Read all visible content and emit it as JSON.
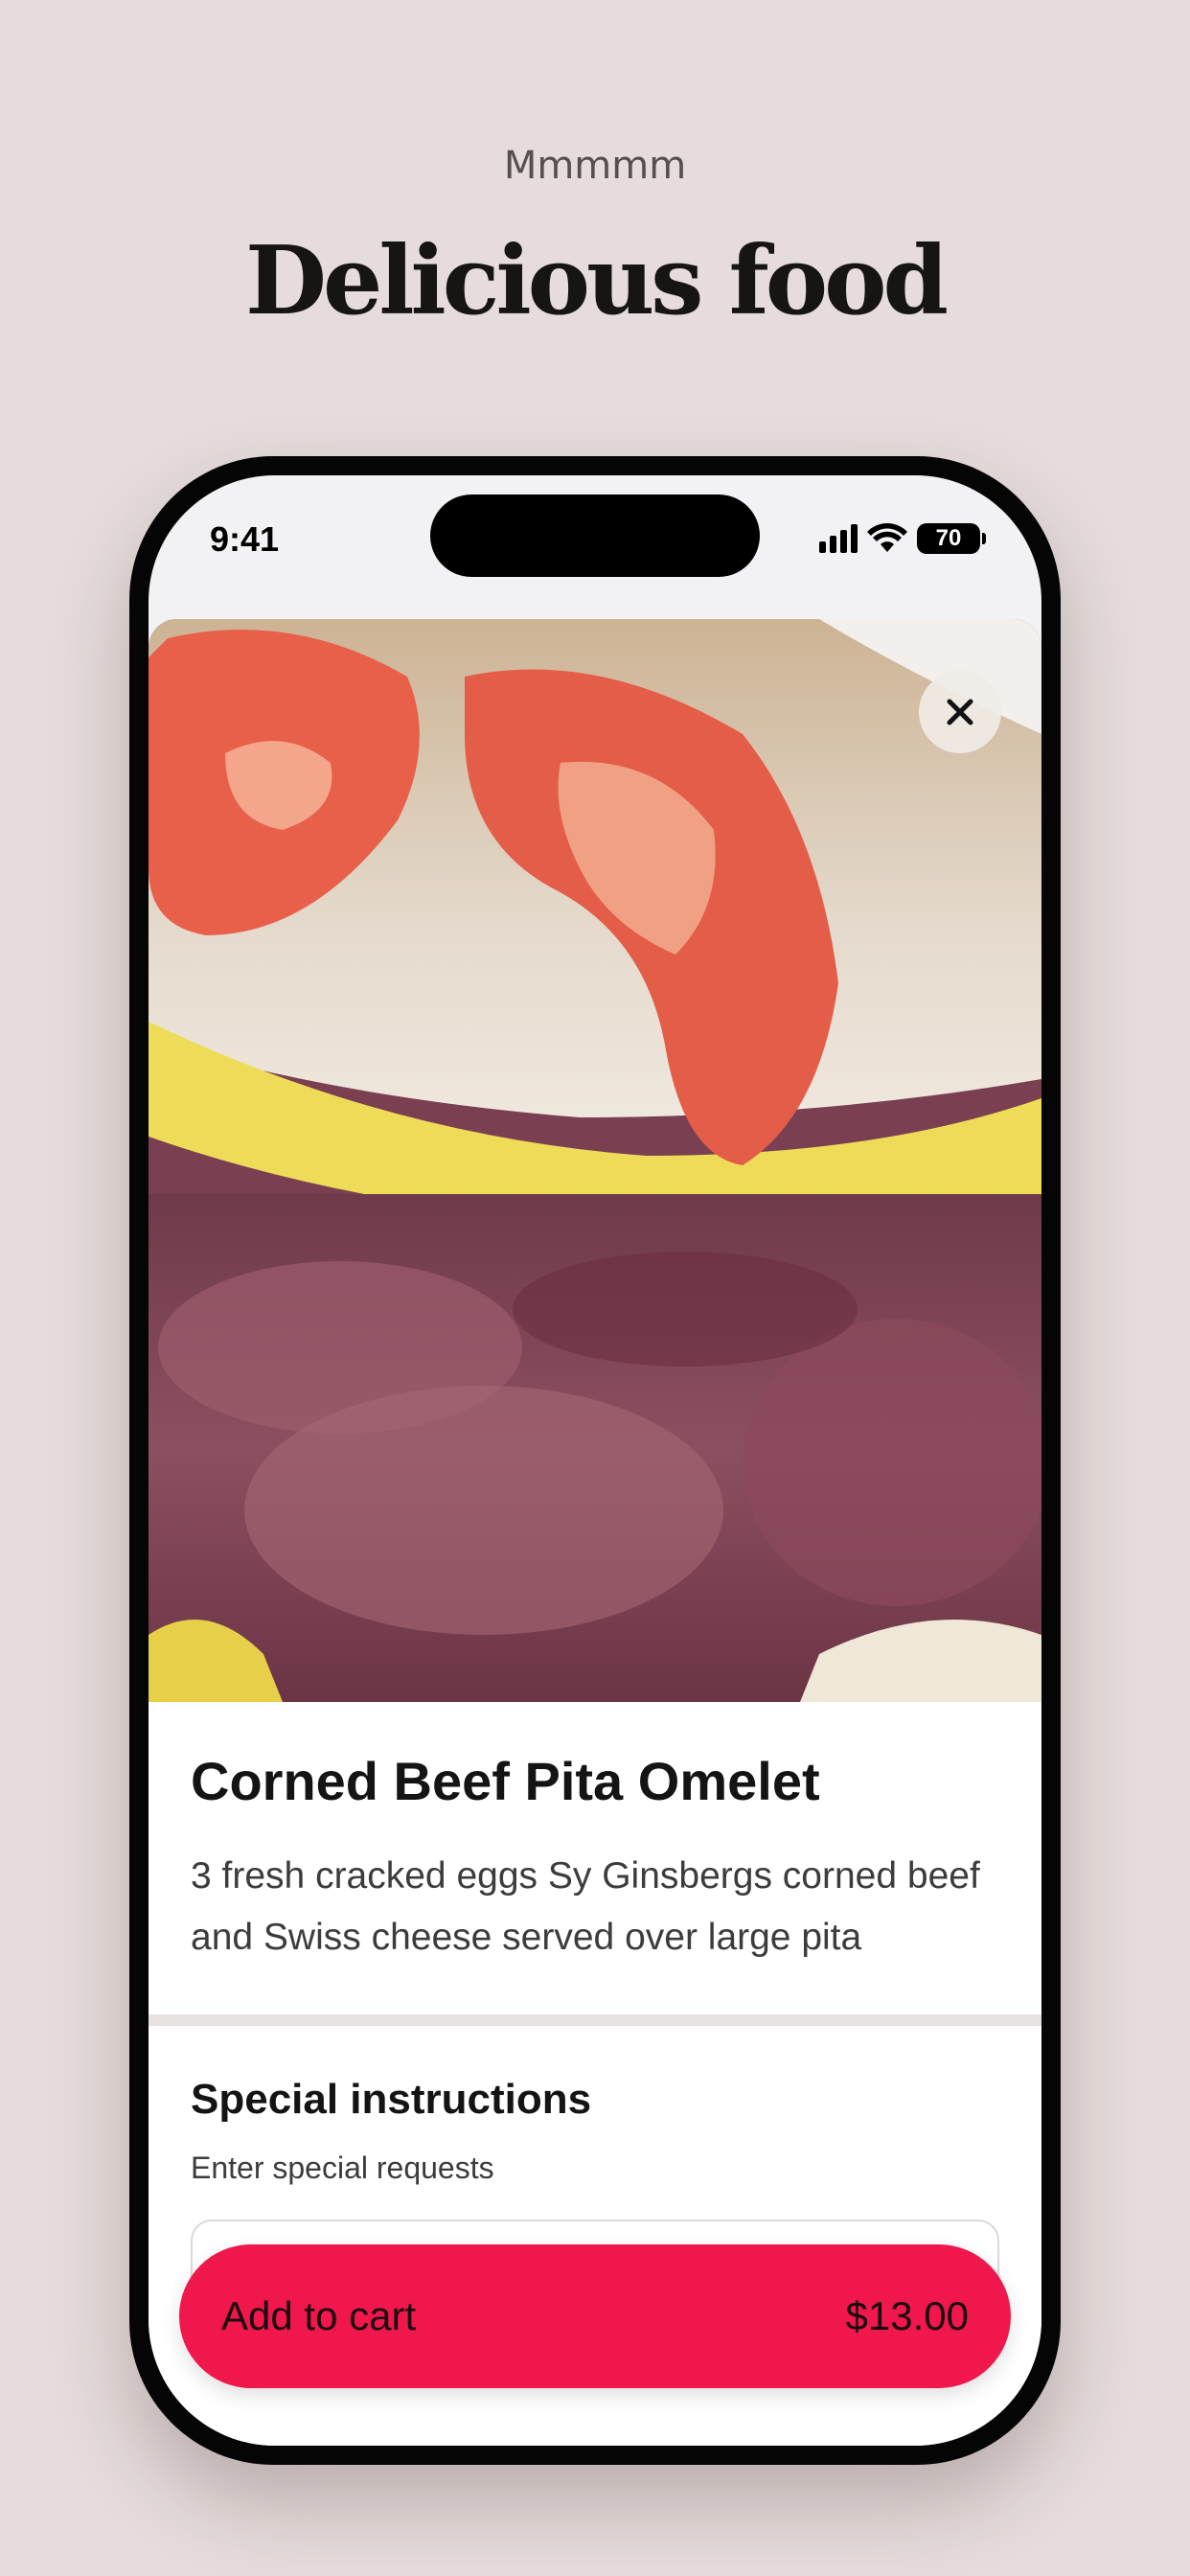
{
  "header": {
    "kicker": "Mmmmm",
    "title": "Delicious food"
  },
  "status_bar": {
    "time": "9:41",
    "battery": "70"
  },
  "item": {
    "image_alt": "Corned beef pita omelet with tomato slices",
    "title": "Corned Beef Pita Omelet",
    "description": "3 fresh cracked eggs Sy Ginsbergs corned beef and Swiss cheese served over large pita"
  },
  "instructions": {
    "title": "Special instructions",
    "subtitle": "Enter special requests",
    "value": ""
  },
  "cart": {
    "label": "Add to cart",
    "price": "$13.00"
  },
  "colors": {
    "background": "#e5dcdb",
    "accent": "#f0174c"
  }
}
